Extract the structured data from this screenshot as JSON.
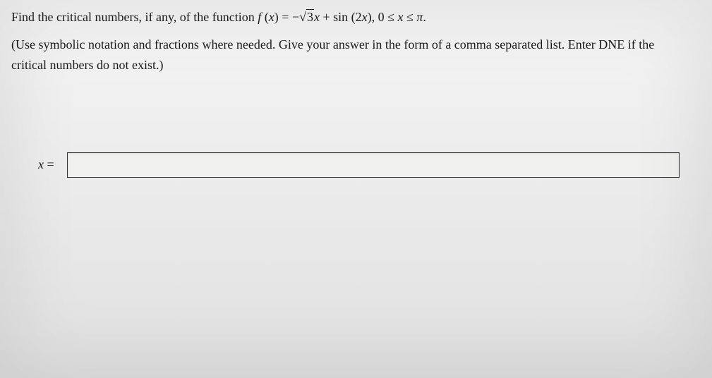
{
  "problem": {
    "line1_prefix": "Find the critical numbers, if any, of the function ",
    "function_label": "f",
    "function_arg_open": " (",
    "function_var": "x",
    "function_arg_close": ") = ",
    "neg": "−",
    "sqrt3": "3",
    "after_sqrt": "x",
    "plus": " + sin (2",
    "sin_var": "x",
    "sin_close": "), 0 ≤ ",
    "domain_var": "x",
    "domain_end": " ≤ ",
    "pi": "π",
    "period": ".",
    "line2": "(Use symbolic notation and fractions where needed. Give your answer in the form of a comma separated list. Enter DNE if the",
    "line3": "critical numbers do not exist.)"
  },
  "answer": {
    "label_var": "x",
    "label_eq": " = ",
    "value": ""
  }
}
